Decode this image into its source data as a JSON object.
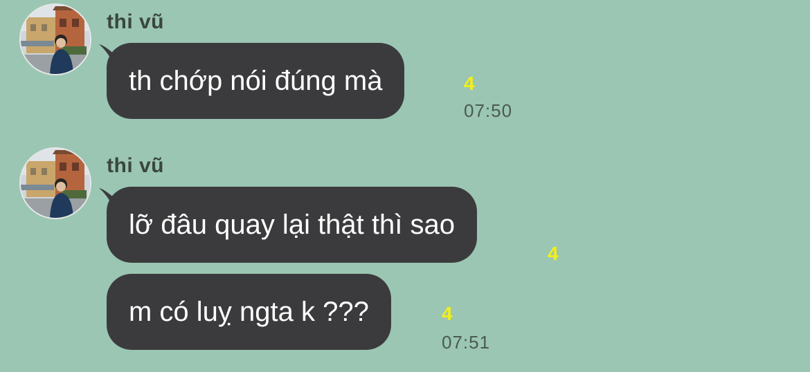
{
  "messages": [
    {
      "sender": "thi vũ",
      "bubbles": [
        {
          "text": "th chớp nói đúng mà",
          "read_count": "4",
          "time": "07:50"
        }
      ]
    },
    {
      "sender": "thi vũ",
      "bubbles": [
        {
          "text": "lỡ đâu quay lại thật thì sao",
          "read_count": "4",
          "time": ""
        },
        {
          "text": "m có luỵ ngta k ???",
          "read_count": "4",
          "time": "07:51"
        }
      ]
    }
  ],
  "colors": {
    "background": "#9bc6b3",
    "bubble": "#3b3b3d",
    "bubble_text": "#ffffff",
    "read_count": "#f2ef1b",
    "time": "#4a5a52",
    "sender": "#3a4640"
  }
}
